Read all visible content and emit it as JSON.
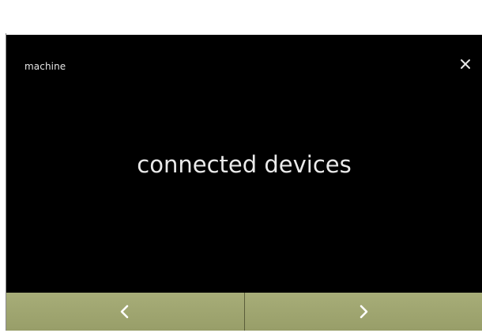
{
  "screen": {
    "title": "machine",
    "heading": "connected devices",
    "close_icon": "close-icon"
  },
  "nav": {
    "prev_icon": "chevron-left-icon",
    "next_icon": "chevron-right-icon"
  },
  "colors": {
    "screen_background": "#000000",
    "text": "#e6e6e6",
    "nav_background": "#9aa06c"
  }
}
